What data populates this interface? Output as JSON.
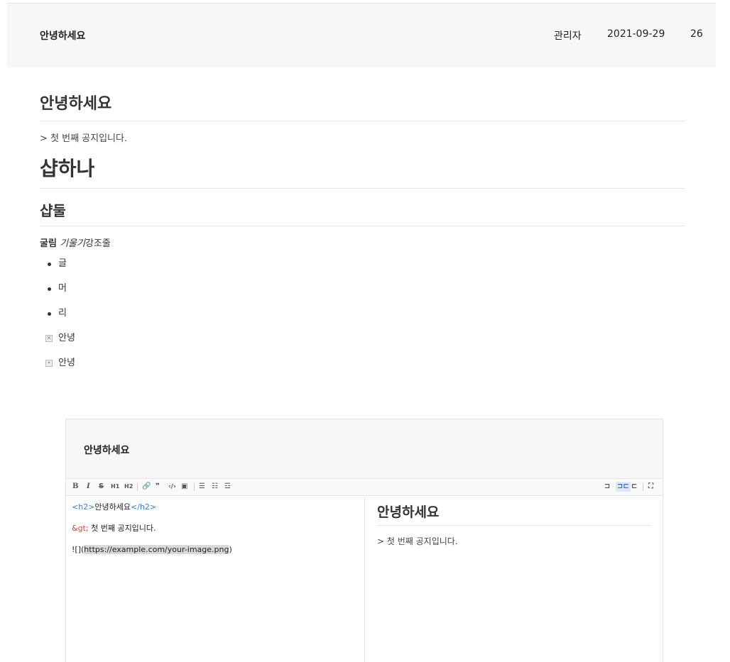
{
  "post": {
    "title": "안녕하세요",
    "author": "관리자",
    "date": "2021-09-29",
    "views": "26"
  },
  "content": {
    "h2": "안녕하세요",
    "quote_line": "> 첫 번째 공지입니다.",
    "h1": "샵하나",
    "h2b": "샵둘",
    "rich_bold": "굴림",
    "rich_italic": "기울기",
    "rich_rest": "강조줄",
    "list": [
      "글",
      "머",
      "리"
    ],
    "tasks": [
      {
        "label": "안녕",
        "mark": "☒"
      },
      {
        "label": "안녕",
        "mark": "◉"
      }
    ]
  },
  "editor": {
    "title": "안녕하세요",
    "toolbar_left": [
      "B",
      "I",
      "S",
      "H1",
      "H2",
      "link",
      "quote",
      "code",
      "image",
      "ul",
      "ol",
      "task"
    ],
    "toolbar_right": [
      "split-left",
      "split-both",
      "split-right",
      "fullscreen"
    ],
    "source": {
      "line1_tag_open": "<h2>",
      "line1_text": "안녕하세요",
      "line1_tag_close": "</h2>",
      "line2_entity": "&gt;",
      "line2_text": " 첫 번째 공지입니다.",
      "line3_prefix": "![](",
      "line3_url": "https://example.com/your-image.png",
      "line3_suffix": ")"
    },
    "preview": {
      "h2": "안녕하세요",
      "p": "> 첫 번째 공지입니다."
    }
  }
}
